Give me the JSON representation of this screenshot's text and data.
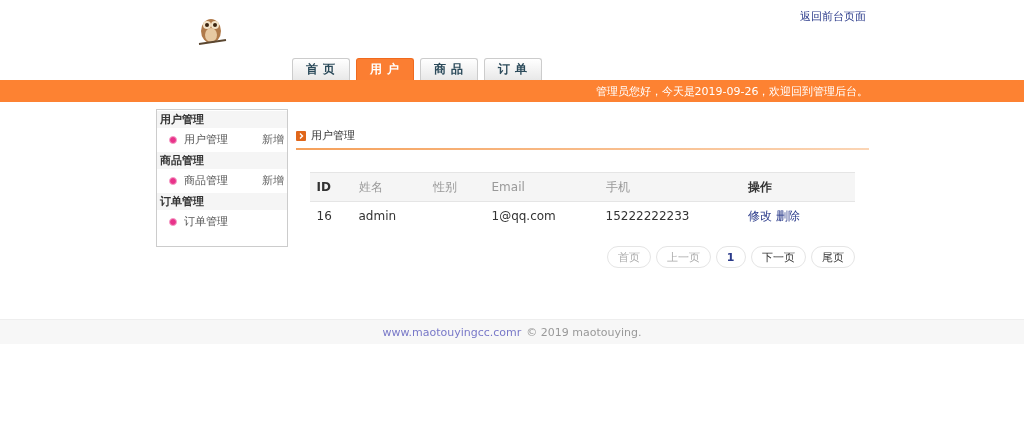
{
  "header": {
    "back_link": "返回前台页面"
  },
  "tabs": [
    {
      "label": "首 页",
      "selected": false
    },
    {
      "label": "用 户",
      "selected": true
    },
    {
      "label": "商 品",
      "selected": false
    },
    {
      "label": "订 单",
      "selected": false
    }
  ],
  "banner": {
    "greeting": "管理员您好，今天是2019-09-26，欢迎回到管理后台。"
  },
  "sidebar": {
    "groups": [
      {
        "title": "用户管理",
        "items": [
          {
            "label": "用户管理",
            "action": "新增"
          }
        ]
      },
      {
        "title": "商品管理",
        "items": [
          {
            "label": "商品管理",
            "action": "新增"
          }
        ]
      },
      {
        "title": "订单管理",
        "items": [
          {
            "label": "订单管理"
          }
        ]
      }
    ]
  },
  "main": {
    "title": "用户管理",
    "table": {
      "columns": [
        {
          "label": "ID",
          "emphasis": true
        },
        {
          "label": "姓名",
          "emphasis": false
        },
        {
          "label": "性别",
          "emphasis": false
        },
        {
          "label": "Email",
          "emphasis": false
        },
        {
          "label": "手机",
          "emphasis": false
        },
        {
          "label": "操作",
          "emphasis": true
        }
      ],
      "rows": [
        {
          "cells": [
            "16",
            "admin",
            "",
            "1@qq.com",
            "15222222233"
          ],
          "actions": [
            "修改",
            "删除"
          ]
        }
      ]
    },
    "pagination": [
      {
        "label": "首页",
        "disabled": true,
        "selected": false
      },
      {
        "label": "上一页",
        "disabled": true,
        "selected": false
      },
      {
        "label": "1",
        "disabled": false,
        "selected": true
      },
      {
        "label": "下一页",
        "disabled": false,
        "selected": false
      },
      {
        "label": "尾页",
        "disabled": false,
        "selected": false
      }
    ]
  },
  "footer": {
    "link": "www.maotouyingcc.comr",
    "text": "© 2019 maotouying."
  }
}
